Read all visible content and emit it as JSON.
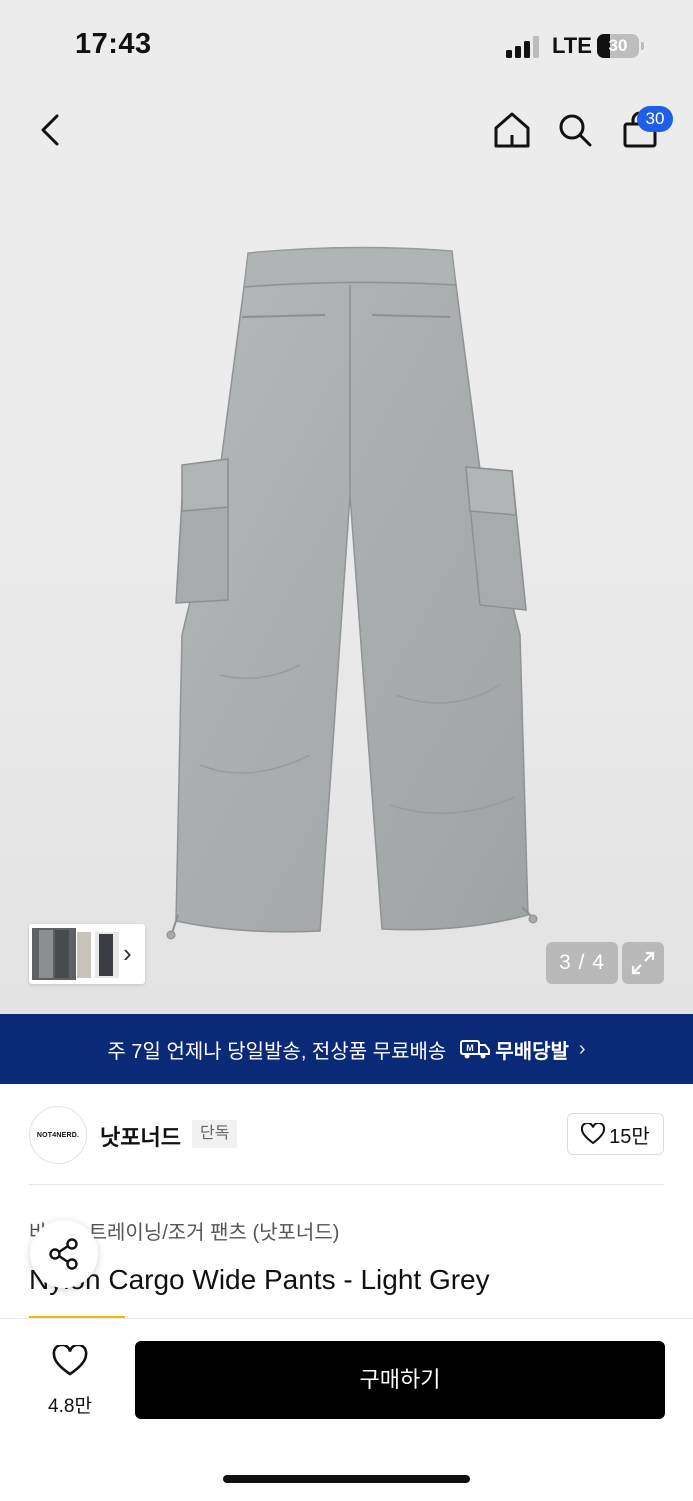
{
  "status_bar": {
    "time": "17:43",
    "network": "LTE",
    "battery": "30",
    "battery_level": 0.3
  },
  "top_nav": {
    "back_icon": "chevron-left-icon",
    "home_icon": "home-icon",
    "search_icon": "search-icon",
    "cart_icon": "shopping-bag-icon",
    "cart_count": "30"
  },
  "gallery": {
    "counter": "3 / 4",
    "expand_icon": "expand-icon",
    "thumb_next": "›"
  },
  "banner": {
    "text": "주 7일 언제나 당일발송, 전상품 무료배송",
    "brand": "무배당발",
    "chevron": "›",
    "background": "#0a2a78"
  },
  "brand": {
    "logo_text": "NOT4NERD.",
    "name": "낫포너드",
    "tag": "단독",
    "like_count": "15만"
  },
  "product": {
    "category": "바지 > 트레이닝/조거 팬츠 (낫포너드)",
    "title": "Nylon Cargo Wide Pants - Light Grey"
  },
  "bottom_bar": {
    "like_count": "4.8만",
    "buy_label": "구매하기"
  },
  "colors": {
    "cart_badge": "#1f5fe8",
    "accent": "#f2b705",
    "buy_button": "#000000"
  }
}
